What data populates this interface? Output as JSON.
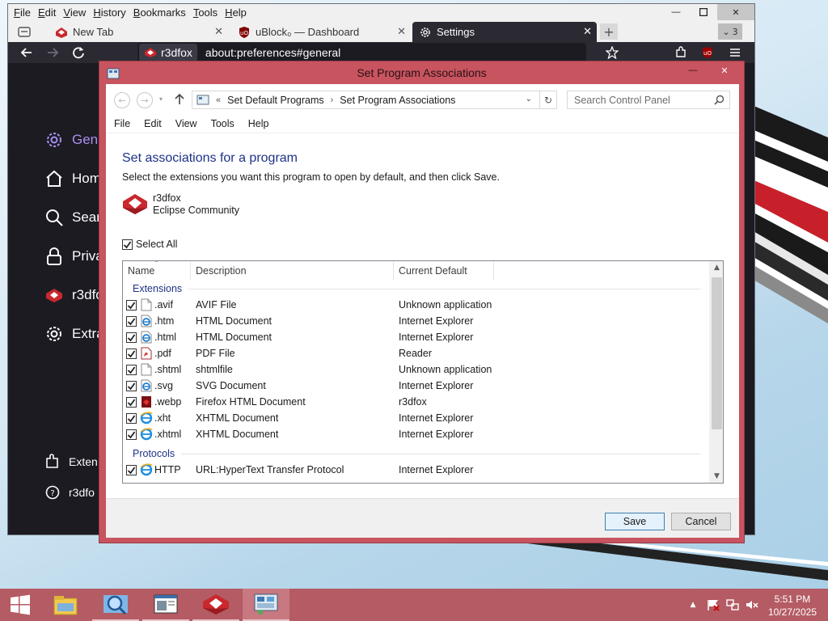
{
  "browser": {
    "menu": [
      "File",
      "Edit",
      "View",
      "History",
      "Bookmarks",
      "Tools",
      "Help"
    ],
    "tabs": [
      {
        "label": "New Tab",
        "icon": "r3dfox-icon"
      },
      {
        "label": "uBlock₀ — Dashboard",
        "icon": "ublock-icon"
      },
      {
        "label": "Settings",
        "icon": "gear-icon"
      }
    ],
    "tab_overflow_count": "3",
    "url_identity": "r3dfox",
    "url": "about:preferences#general",
    "sidebar": [
      {
        "label": "Gene",
        "icon": "gear-icon"
      },
      {
        "label": "Hom",
        "icon": "home-icon"
      },
      {
        "label": "Searc",
        "icon": "search-icon"
      },
      {
        "label": "Priva",
        "icon": "lock-icon"
      },
      {
        "label": "r3dfo",
        "icon": "r3dfox-icon"
      },
      {
        "label": "Extra",
        "icon": "gear-icon"
      }
    ],
    "sidebar_bottom": [
      {
        "label": "Exten",
        "icon": "puzzle-icon"
      },
      {
        "label": "r3dfo",
        "icon": "help-icon"
      }
    ],
    "accent": "#a98ff0"
  },
  "dialog": {
    "title": "Set Program Associations",
    "breadcrumb": [
      "Set Default Programs",
      "Set Program Associations"
    ],
    "search_placeholder": "Search Control Panel",
    "menu": [
      "File",
      "Edit",
      "View",
      "Tools",
      "Help"
    ],
    "heading": "Set associations for a program",
    "instruction": "Select the extensions you want this program to open by default, and then click Save.",
    "program": {
      "name": "r3dfox",
      "publisher": "Eclipse Community"
    },
    "select_all_label": "Select All",
    "columns": {
      "name": "Name",
      "description": "Description",
      "current_default": "Current Default"
    },
    "groups": {
      "extensions": {
        "label": "Extensions",
        "rows": [
          {
            "name": ".avif",
            "description": "AVIF File",
            "default": "Unknown application",
            "checked": true,
            "icon": "blank-file-icon"
          },
          {
            "name": ".htm",
            "description": "HTML Document",
            "default": "Internet Explorer",
            "checked": true,
            "icon": "ie-file-icon"
          },
          {
            "name": ".html",
            "description": "HTML Document",
            "default": "Internet Explorer",
            "checked": true,
            "icon": "ie-file-icon"
          },
          {
            "name": ".pdf",
            "description": "PDF File",
            "default": "Reader",
            "checked": true,
            "icon": "pdf-icon"
          },
          {
            "name": ".shtml",
            "description": "shtmlfile",
            "default": "Unknown application",
            "checked": true,
            "icon": "blank-file-icon"
          },
          {
            "name": ".svg",
            "description": "SVG Document",
            "default": "Internet Explorer",
            "checked": true,
            "icon": "ie-file-icon"
          },
          {
            "name": ".webp",
            "description": "Firefox HTML Document",
            "default": "r3dfox",
            "checked": true,
            "icon": "r3dfox-file-icon"
          },
          {
            "name": ".xht",
            "description": "XHTML Document",
            "default": "Internet Explorer",
            "checked": true,
            "icon": "ie-icon"
          },
          {
            "name": ".xhtml",
            "description": "XHTML Document",
            "default": "Internet Explorer",
            "checked": true,
            "icon": "ie-icon"
          }
        ]
      },
      "protocols": {
        "label": "Protocols",
        "rows": [
          {
            "name": "HTTP",
            "description": "URL:HyperText Transfer Protocol",
            "default": "Internet Explorer",
            "checked": true,
            "icon": "ie-icon"
          }
        ]
      }
    },
    "save_label": "Save",
    "cancel_label": "Cancel",
    "title_color": "#c7545f",
    "heading_color": "#1e3287"
  },
  "taskbar": {
    "apps": [
      "file-explorer-icon",
      "magnifier-icon",
      "document-viewer-icon",
      "r3dfox-icon",
      "control-panel-icon"
    ],
    "time": "5:51 PM",
    "date": "10/27/2025",
    "color": "#b45b63"
  }
}
